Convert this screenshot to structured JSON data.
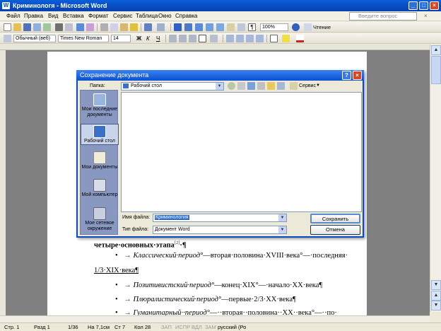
{
  "window": {
    "title": "Криминологя - Microsoft Word",
    "app_icon": "word-icon",
    "controls": {
      "minimize": "_",
      "maximize": "□",
      "close": "×"
    }
  },
  "menu": {
    "items": [
      "Файл",
      "Правка",
      "Вид",
      "Вставка",
      "Формат",
      "Сервис",
      "Таблица",
      "Окно",
      "Справка"
    ],
    "help_placeholder": "Введите вопрос"
  },
  "toolbar_standard": {
    "zoom": "100%",
    "read_label": "Чтение"
  },
  "toolbar_formatting": {
    "style": "Обычный (веб)",
    "font": "Times New Roman",
    "size": "14",
    "bold": "Ж",
    "italic": "К",
    "underline": "Ч"
  },
  "document": {
    "lines": {
      "l1": "четыре·основных·этапа",
      "l1_ref": "[2]",
      "l1_end": "·¶",
      "b1_it": "Классический·период°",
      "b1_rest": "—вторая·половина·XVIII·века°—·последняя·",
      "l2": "1/3·XIX·века¶",
      "b2_it": "Позитивистский·период°",
      "b2_rest": "—конец·XIX°—·начало·XX·века¶",
      "b3_it": "Плюралистический·период°",
      "b3_rest": "—первые·2/3·XX·века¶",
      "b4_it": "Гуманитарный··период°",
      "b4_rest": "—··вторая··половина··XX··века°—··по·"
    },
    "bullet": "•",
    "tab_arrow": "→"
  },
  "dialog": {
    "title": "Сохранение документа",
    "folder_label": "Папка:",
    "folder_value": "Рабочий стол",
    "tools_label": "Сервис",
    "places": [
      {
        "label": "Мои последние документы",
        "icon": "recent-documents-icon"
      },
      {
        "label": "Рабочий стол",
        "icon": "desktop-icon"
      },
      {
        "label": "Мои документы",
        "icon": "my-documents-icon"
      },
      {
        "label": "Мой компьютер",
        "icon": "my-computer-icon"
      },
      {
        "label": "Мое сетевое окружение",
        "icon": "network-places-icon"
      }
    ],
    "filename_label": "Имя файла:",
    "filename_value": "Криминология",
    "filetype_label": "Тип файла:",
    "filetype_value": "Документ Word",
    "save_label": "Сохранить",
    "cancel_label": "Отмена"
  },
  "status": {
    "page": "Стр. 1",
    "section": "Разд 1",
    "pages": "1/36",
    "position": "На 7,1см",
    "line": "Ст 7",
    "col": "Кол 28",
    "rec": "ЗАП",
    "trk": "ИСПР",
    "ext": "ВДЛ",
    "ovr": "ЗАМ",
    "language": "русский (Ро"
  }
}
